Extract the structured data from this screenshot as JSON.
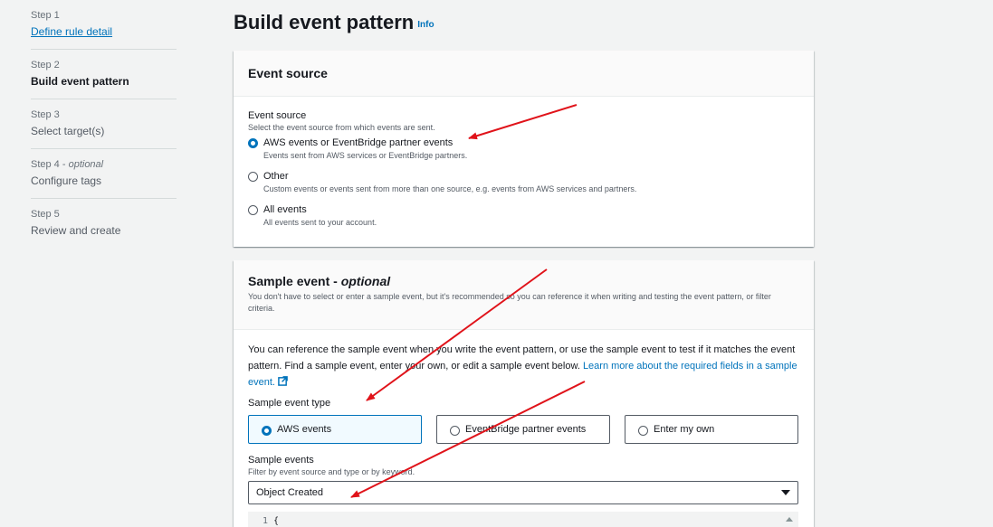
{
  "steps": [
    {
      "num": "Step 1",
      "optional": "",
      "title": "Define rule detail",
      "state": "link"
    },
    {
      "num": "Step 2",
      "optional": "",
      "title": "Build event pattern",
      "state": "current"
    },
    {
      "num": "Step 3",
      "optional": "",
      "title": "Select target(s)",
      "state": "normal"
    },
    {
      "num": "Step 4 - ",
      "optional": "optional",
      "title": "Configure tags",
      "state": "normal"
    },
    {
      "num": "Step 5",
      "optional": "",
      "title": "Review and create",
      "state": "normal"
    }
  ],
  "header": {
    "title": "Build event pattern",
    "info": "Info"
  },
  "event_source_panel": {
    "heading": "Event source",
    "field_label": "Event source",
    "field_hint": "Select the event source from which events are sent.",
    "options": [
      {
        "label": "AWS events or EventBridge partner events",
        "desc": "Events sent from AWS services or EventBridge partners.",
        "selected": true
      },
      {
        "label": "Other",
        "desc": "Custom events or events sent from more than one source, e.g. events from AWS services and partners.",
        "selected": false
      },
      {
        "label": "All events",
        "desc": "All events sent to your account.",
        "selected": false
      }
    ]
  },
  "sample_event_panel": {
    "heading": "Sample event - ",
    "heading_optional": "optional",
    "desc": "You don't have to select or enter a sample event, but it's recommended so you can reference it when writing and testing the event pattern, or filter criteria.",
    "para_text": "You can reference the sample event when you write the event pattern, or use the sample event to test if it matches the event pattern. Find a sample event, enter your own, or edit a sample event below. ",
    "para_link": "Learn more about the required fields in a sample event.",
    "type_label": "Sample event type",
    "types": [
      {
        "label": "AWS events",
        "selected": true
      },
      {
        "label": "EventBridge partner events",
        "selected": false
      },
      {
        "label": "Enter my own",
        "selected": false
      }
    ],
    "events_label": "Sample events",
    "events_hint": "Filter by event source and type or by keyword.",
    "events_value": "Object Created",
    "editor_line": "1",
    "editor_code": "{"
  },
  "colors": {
    "accent": "#0073bb",
    "arrow": "#e0131a"
  }
}
